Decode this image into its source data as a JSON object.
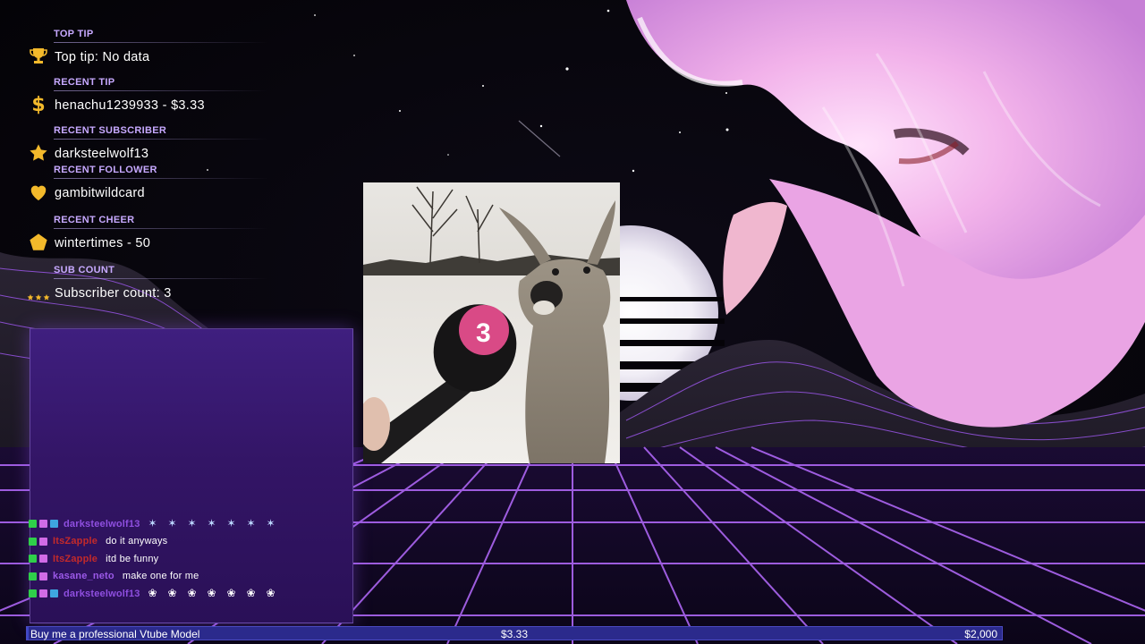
{
  "alerts": [
    {
      "heading": "TOP TIP",
      "value": "Top tip: No data",
      "icon": "trophy-icon"
    },
    {
      "heading": "RECENT TIP",
      "value": "henachu1239933 - $3.33",
      "icon": "dollar-icon"
    },
    {
      "heading": "RECENT SUBSCRIBER",
      "value": "darksteelwolf13",
      "icon": "star-icon"
    },
    {
      "heading": "RECENT FOLLOWER",
      "value": "gambitwildcard",
      "icon": "heart-icon"
    },
    {
      "heading": "RECENT CHEER",
      "value": "wintertimes - 50",
      "icon": "pentagon-gem-icon"
    },
    {
      "heading": "SUB COUNT",
      "value": "Subscriber count: 3",
      "icon": "three-stars-icon"
    }
  ],
  "chat": {
    "messages": [
      {
        "user": "darksteelwolf13",
        "user_color": "#8f4fe0",
        "message": "",
        "badges": [
          "green",
          "pink",
          "blue"
        ],
        "emotes": [
          "dance",
          "dance",
          "dance",
          "dance",
          "dance",
          "dance",
          "dance"
        ]
      },
      {
        "user": "ItsZapple",
        "user_color": "#c42a2a",
        "message": "do it anyways",
        "badges": [
          "green",
          "pink"
        ],
        "emotes": []
      },
      {
        "user": "ItsZapple",
        "user_color": "#c42a2a",
        "message": "itd be funny",
        "badges": [
          "green",
          "pink"
        ],
        "emotes": []
      },
      {
        "user": "kasane_neto",
        "user_color": "#9b59e8",
        "message": "make one for me",
        "badges": [
          "green",
          "pink"
        ],
        "emotes": []
      },
      {
        "user": "darksteelwolf13",
        "user_color": "#8f4fe0",
        "message": "",
        "badges": [
          "green",
          "pink",
          "blue"
        ],
        "emotes": [
          "cat",
          "cat",
          "cat",
          "cat",
          "cat",
          "cat",
          "cat"
        ]
      }
    ]
  },
  "goal": {
    "title": "Buy me a professional Vtube Model",
    "current": "$3.33",
    "target": "$2,000",
    "progress_fraction": 0.00167
  },
  "colors": {
    "accent_purple": "#a85cff",
    "heading_purple": "#c7a9ff",
    "icon_gold": "#f3b92b",
    "goal_bar": "#2b2a8c"
  }
}
